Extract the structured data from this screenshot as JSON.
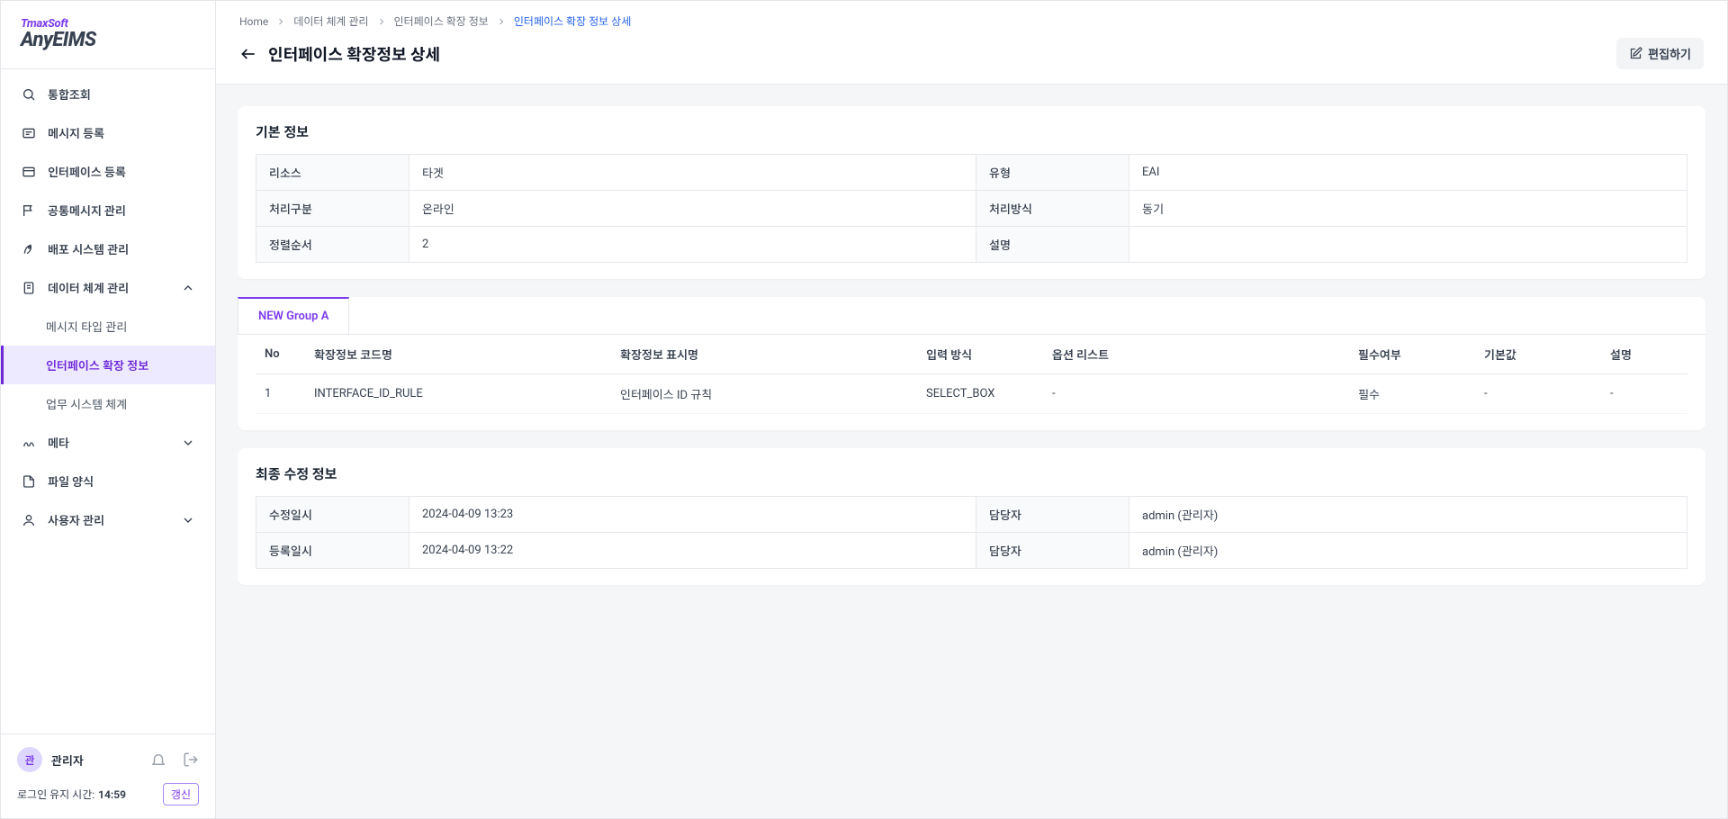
{
  "brand": {
    "company": "TmaxSoft",
    "product": "AnyEIMS"
  },
  "nav": {
    "items": {
      "search": "통합조회",
      "message_reg": "메시지 등록",
      "interface_reg": "인터페이스 등록",
      "common_msg": "공통메시지 관리",
      "deploy": "배포 시스템 관리",
      "data_system": "데이터 체계 관리",
      "meta": "메타",
      "file_template": "파일 양식",
      "user_mgmt": "사용자 관리"
    },
    "sub": {
      "msg_type": "메시지 타입 관리",
      "iface_ext": "인터페이스 확장 정보",
      "biz_system": "업무 시스템 체계"
    }
  },
  "footer": {
    "avatar_letter": "관",
    "user_name": "관리자",
    "login_label": "로그인 유지 시간:",
    "login_time": "14:59",
    "refresh": "갱신"
  },
  "breadcrumb": {
    "home": "Home",
    "l1": "데이터 체계 관리",
    "l2": "인터페이스 확장 정보",
    "l3": "인터페이스 확장 정보 상세"
  },
  "page": {
    "title": "인터페이스 확장정보 상세",
    "edit_button": "편집하기"
  },
  "basic_info": {
    "section_title": "기본 정보",
    "rows": {
      "resource_label": "리소스",
      "resource_value": "타겟",
      "type_label": "유형",
      "type_value": "EAI",
      "process_div_label": "처리구분",
      "process_div_value": "온라인",
      "process_method_label": "처리방식",
      "process_method_value": "동기",
      "sort_label": "정렬순서",
      "sort_value": "2",
      "desc_label": "설명",
      "desc_value": ""
    }
  },
  "group": {
    "tab_label": "NEW Group A",
    "columns": {
      "no": "No",
      "code": "확장정보 코드명",
      "display": "확장정보 표시명",
      "input": "입력 방식",
      "options": "옵션 리스트",
      "required": "필수여부",
      "default": "기본값",
      "desc": "설명"
    },
    "row1": {
      "no": "1",
      "code": "INTERFACE_ID_RULE",
      "display": "인터페이스 ID 규칙",
      "input": "SELECT_BOX",
      "options": "-",
      "required": "필수",
      "default": "-",
      "desc": "-"
    }
  },
  "mod_info": {
    "section_title": "최종 수정 정보",
    "rows": {
      "mod_dt_label": "수정일시",
      "mod_dt_value": "2024-04-09 13:23",
      "mod_by_label": "담당자",
      "mod_by_value": "admin (관리자)",
      "reg_dt_label": "등록일시",
      "reg_dt_value": "2024-04-09 13:22",
      "reg_by_label": "담당자",
      "reg_by_value": "admin (관리자)"
    }
  }
}
